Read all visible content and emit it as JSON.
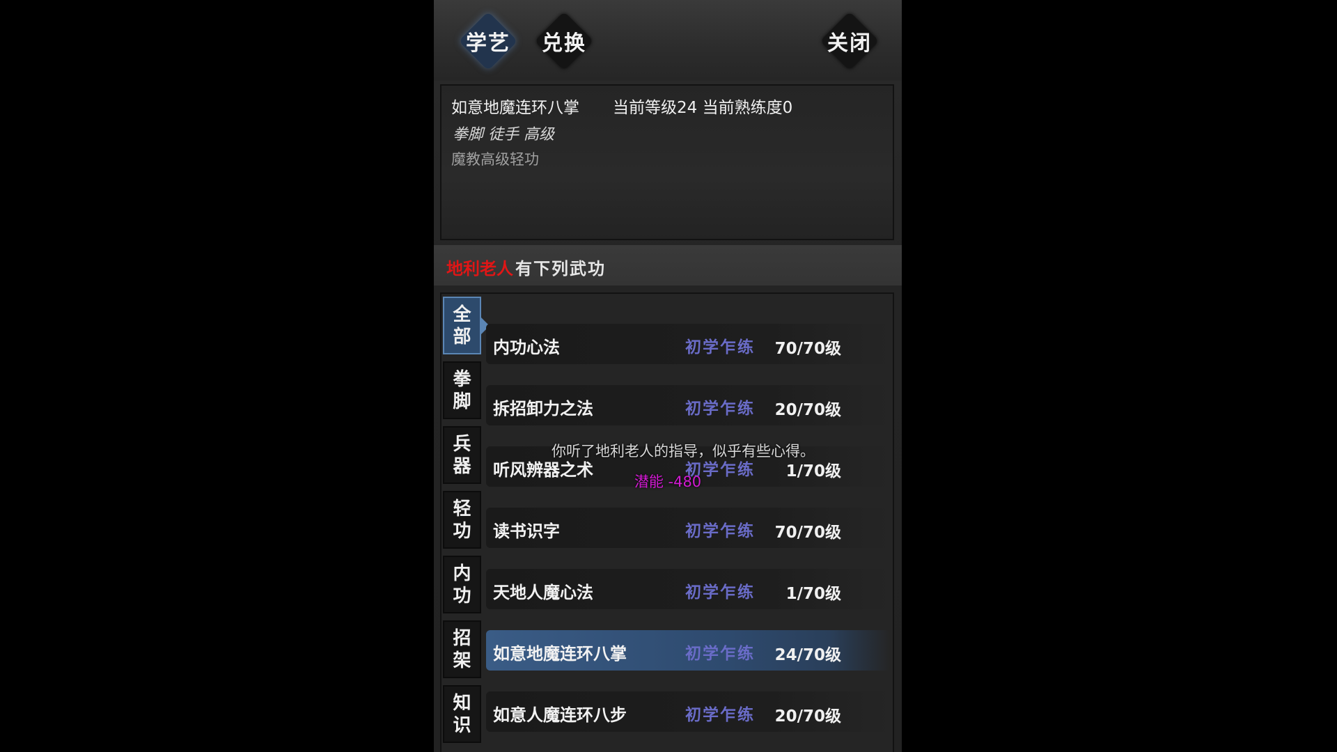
{
  "tabs": {
    "learn": "学艺",
    "exchange": "兑换",
    "close": "关闭"
  },
  "skill_info": {
    "name": "如意地魔连环八掌",
    "level_text": "当前等级24  当前熟练度0",
    "tags": "拳脚 徒手 高级",
    "description": "魔教高级轻功"
  },
  "master": {
    "name": "地利老人",
    "suffix": "有下列武功"
  },
  "categories": [
    {
      "top": "全",
      "bottom": "部"
    },
    {
      "top": "拳",
      "bottom": "脚"
    },
    {
      "top": "兵",
      "bottom": "器"
    },
    {
      "top": "轻",
      "bottom": "功"
    },
    {
      "top": "内",
      "bottom": "功"
    },
    {
      "top": "招",
      "bottom": "架"
    },
    {
      "top": "知",
      "bottom": "识"
    }
  ],
  "skills": [
    {
      "name": "内功心法",
      "stage": "初学乍练",
      "level": "70/70级"
    },
    {
      "name": "拆招卸力之法",
      "stage": "初学乍练",
      "level": "20/70级"
    },
    {
      "name": "听风辨器之术",
      "stage": "初学乍练",
      "level": "1/70级"
    },
    {
      "name": "读书识字",
      "stage": "初学乍练",
      "level": "70/70级"
    },
    {
      "name": "天地人魔心法",
      "stage": "初学乍练",
      "level": "1/70级"
    },
    {
      "name": "如意地魔连环八掌",
      "stage": "初学乍练",
      "level": "24/70级"
    },
    {
      "name": "如意人魔连环八步",
      "stage": "初学乍练",
      "level": "20/70级"
    }
  ],
  "messages": {
    "guidance": "你听了地利老人的指导，似乎有些心得。",
    "potential": "潜能 -480"
  },
  "colors": {
    "master_name": "#e01616",
    "stage_text": "#6a6cc8",
    "potential": "#d21ad2",
    "selected_row": "#3a5c86"
  }
}
